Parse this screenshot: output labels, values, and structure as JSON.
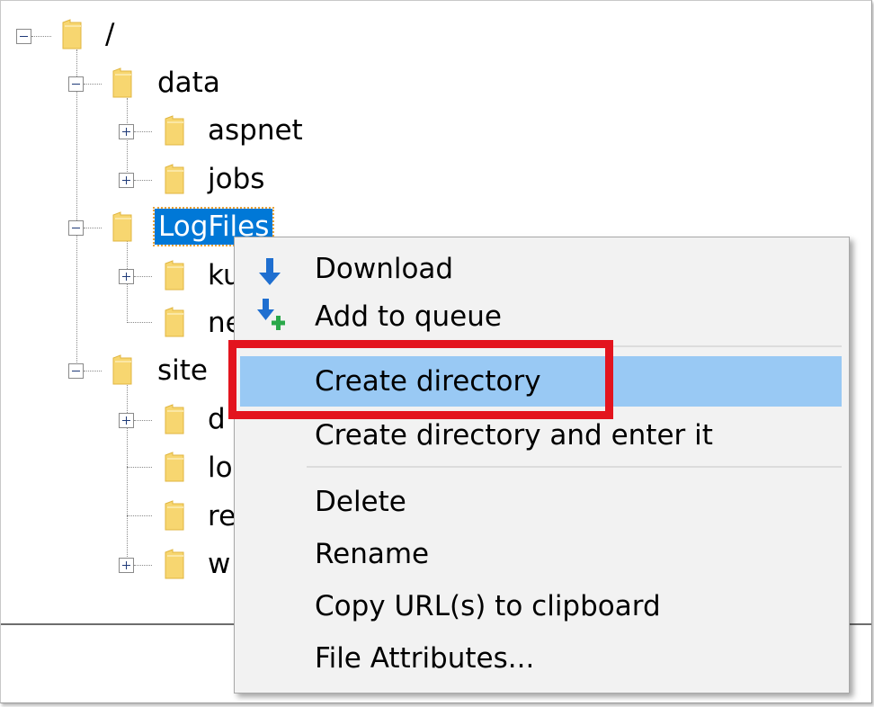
{
  "tree": {
    "root": {
      "label": "/"
    },
    "data": {
      "label": "data"
    },
    "aspnet": {
      "label": "aspnet"
    },
    "jobs": {
      "label": "jobs"
    },
    "logfiles": {
      "label": "LogFiles"
    },
    "ku": {
      "label": "ku"
    },
    "ne": {
      "label": "ne"
    },
    "site": {
      "label": "site"
    },
    "site_d": {
      "label": "d"
    },
    "site_lo": {
      "label": "lo"
    },
    "site_re": {
      "label": "re"
    },
    "site_w": {
      "label": "w"
    }
  },
  "context_menu": {
    "items": [
      {
        "label": "Download",
        "icon": "download-arrow-icon"
      },
      {
        "label": "Add to queue",
        "icon": "add-to-queue-icon"
      },
      {
        "label": "Create directory",
        "highlighted": true
      },
      {
        "label": "Create directory and enter it"
      },
      {
        "label": "Delete"
      },
      {
        "label": "Rename"
      },
      {
        "label": "Copy URL(s) to clipboard"
      },
      {
        "label": "File Attributes..."
      }
    ]
  },
  "colors": {
    "selection": "#0078d7",
    "menu_highlight": "#99c9f4",
    "annotation_box": "#e3141e",
    "folder": "#f7d670"
  }
}
